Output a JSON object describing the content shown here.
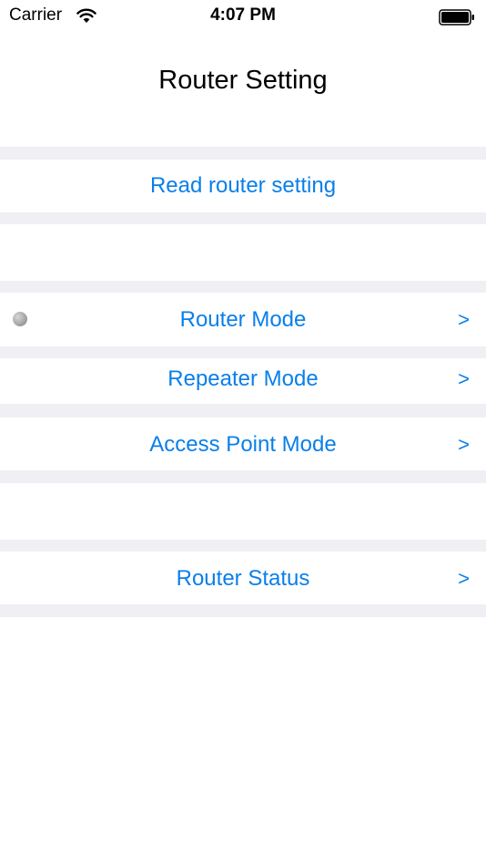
{
  "status_bar": {
    "carrier": "Carrier",
    "time": "4:07 PM"
  },
  "nav": {
    "title": "Router Setting"
  },
  "actions": {
    "read_label": "Read router setting"
  },
  "modes": {
    "items": [
      {
        "label": "Router Mode",
        "chevron": ">",
        "selected": true
      },
      {
        "label": "Repeater Mode",
        "chevron": ">",
        "selected": false
      },
      {
        "label": "Access Point Mode",
        "chevron": ">",
        "selected": false
      }
    ]
  },
  "status_section": {
    "label": "Router Status",
    "chevron": ">"
  },
  "colors": {
    "accent": "#0a7fea",
    "separator": "#efeff4",
    "background": "#ffffff"
  }
}
